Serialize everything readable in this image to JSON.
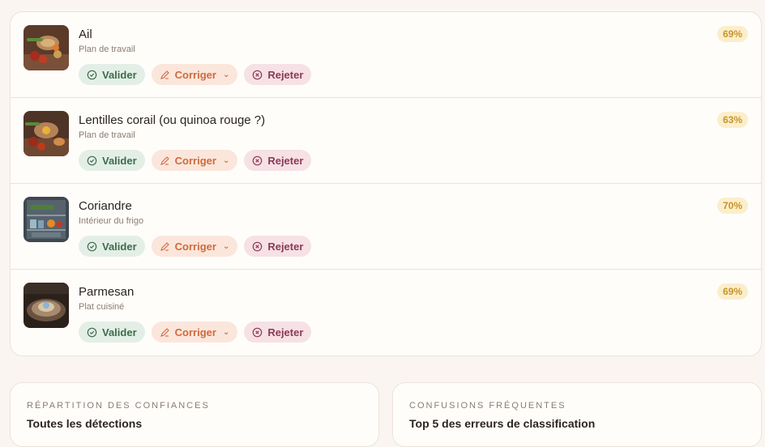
{
  "items": [
    {
      "name": "Ail",
      "context": "Plan de travail",
      "confidence": "69%",
      "thumb": "counter"
    },
    {
      "name": "Lentilles corail (ou quinoa rouge ?)",
      "context": "Plan de travail",
      "confidence": "63%",
      "thumb": "counter"
    },
    {
      "name": "Coriandre",
      "context": "Intérieur du frigo",
      "confidence": "70%",
      "thumb": "fridge"
    },
    {
      "name": "Parmesan",
      "context": "Plat cuisiné",
      "confidence": "69%",
      "thumb": "dish"
    }
  ],
  "actions": {
    "validate": "Valider",
    "correct": "Corriger",
    "reject": "Rejeter"
  },
  "icons": {
    "validate": "check-circle-icon",
    "correct": "pencil-icon",
    "reject": "x-circle-icon",
    "dropdown": "chevron-down-icon"
  },
  "panels": {
    "confidence": {
      "eyebrow": "RÉPARTITION DES CONFIANCES",
      "title": "Toutes les détections"
    },
    "confusions": {
      "eyebrow": "CONFUSIONS FRÉQUENTES",
      "title": "Top 5 des erreurs de classification"
    }
  },
  "colors": {
    "validate": "#3e6b4d",
    "correct": "#d06a3b",
    "reject": "#8c3a56",
    "confidence_badge": "#c9942a"
  }
}
